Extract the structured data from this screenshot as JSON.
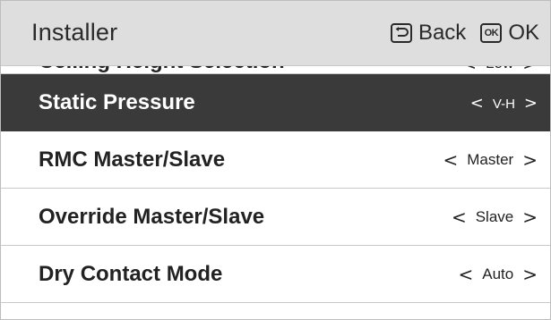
{
  "header": {
    "title": "Installer",
    "back_label": "Back",
    "ok_label": "OK",
    "ok_key_text": "OK"
  },
  "rows": [
    {
      "label": "Ceiling Height Selection",
      "value": "Low"
    },
    {
      "label": "Static Pressure",
      "value": "V-H",
      "selected": true
    },
    {
      "label": "RMC Master/Slave",
      "value": "Master"
    },
    {
      "label": "Override Master/Slave",
      "value": "Slave"
    },
    {
      "label": "Dry Contact Mode",
      "value": "Auto"
    }
  ],
  "icons": {
    "back": "back-arrow-icon",
    "ok": "ok-key-icon",
    "prev": "chevron-left-icon",
    "next": "chevron-right-icon"
  },
  "colors": {
    "header_bg": "#dedede",
    "selected_bg": "#3a3a3a",
    "row_bg": "#ffffff",
    "text": "#222222"
  }
}
